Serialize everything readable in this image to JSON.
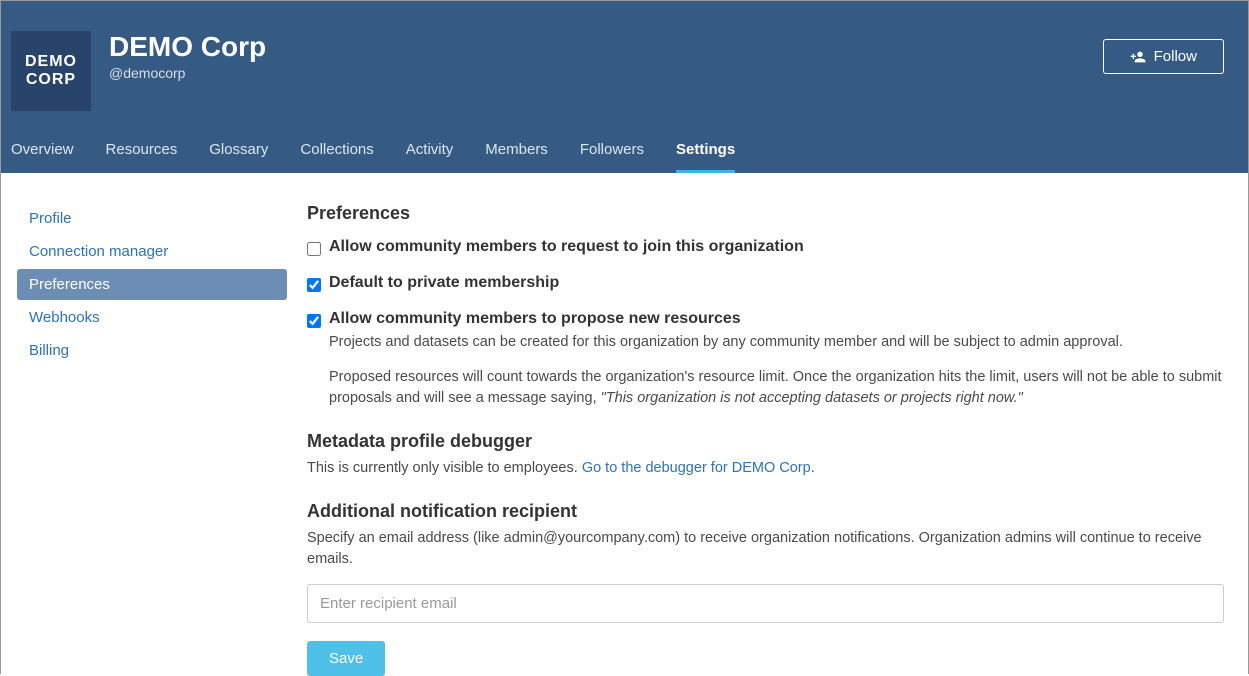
{
  "header": {
    "logo_text": "DEMO CORP",
    "org_title": "DEMO Corp",
    "org_handle": "@democorp",
    "follow_label": "Follow"
  },
  "nav_tabs": [
    "Overview",
    "Resources",
    "Glossary",
    "Collections",
    "Activity",
    "Members",
    "Followers",
    "Settings"
  ],
  "sidebar": {
    "items": [
      "Profile",
      "Connection manager",
      "Preferences",
      "Webhooks",
      "Billing"
    ]
  },
  "content": {
    "title": "Preferences",
    "opt_join": {
      "label": "Allow community members to request to join this organization"
    },
    "opt_private": {
      "label": "Default to private membership"
    },
    "opt_propose": {
      "label": "Allow community members to propose new resources",
      "desc1": "Projects and datasets can be created for this organization by any community member and will be subject to admin approval.",
      "desc2_a": "Proposed resources will count towards the organization's resource limit. Once the organization hits the limit, users will not be able to submit proposals and will see a message saying, ",
      "desc2_b": "\"This organization is not accepting datasets or projects right now.\""
    },
    "debugger": {
      "heading": "Metadata profile debugger",
      "text_a": "This is currently only visible to employees. ",
      "link": "Go to the debugger for DEMO Corp",
      "text_b": "."
    },
    "notification": {
      "heading": "Additional notification recipient",
      "desc": "Specify an email address (like admin@yourcompany.com) to receive organization notifications. Organization admins will continue to receive emails.",
      "placeholder": "Enter recipient email"
    },
    "save_label": "Save"
  }
}
